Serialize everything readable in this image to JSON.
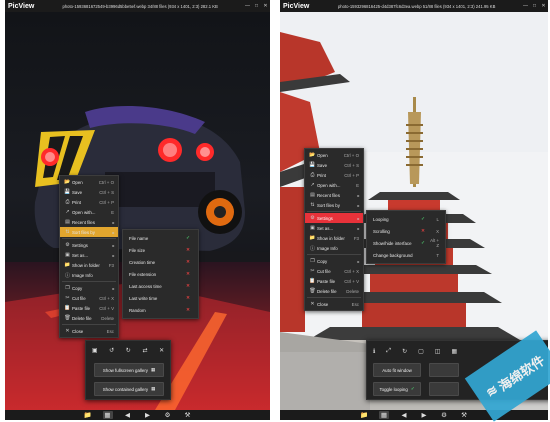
{
  "left": {
    "app_name": "PicView",
    "title": "photo-1593681672549-b3996d5bbe5ef.webp 34/88 files (934 x 1401, 2:3) 282.1 KB",
    "window_controls": [
      "minimize-icon",
      "maximize-icon",
      "close-icon"
    ],
    "context_menu": [
      {
        "icon": "folder-open-icon",
        "label": "Open",
        "shortcut": "Ctrl + O"
      },
      {
        "icon": "save-icon",
        "label": "Save",
        "shortcut": "Ctrl + S"
      },
      {
        "icon": "print-icon",
        "label": "Print",
        "shortcut": "Ctrl + P"
      },
      {
        "icon": "open-with-icon",
        "label": "Open with...",
        "shortcut": "E"
      },
      {
        "icon": "recent-files-icon",
        "label": "Recent files",
        "shortcut": ""
      },
      {
        "icon": "sort-icon",
        "label": "Sort files by",
        "shortcut": ""
      },
      {
        "icon": "settings-icon",
        "label": "Settings",
        "shortcut": ""
      },
      {
        "icon": "set-as-icon",
        "label": "Set as...",
        "shortcut": ""
      },
      {
        "icon": "folder-icon",
        "label": "Show in folder",
        "shortcut": "F3"
      },
      {
        "icon": "image-info-icon",
        "label": "Image Info",
        "shortcut": ""
      },
      {
        "icon": "copy-icon",
        "label": "Copy",
        "shortcut": ""
      },
      {
        "icon": "cut-icon",
        "label": "Cut file",
        "shortcut": "Ctrl + X"
      },
      {
        "icon": "paste-icon",
        "label": "Paste file",
        "shortcut": "Ctrl + V"
      },
      {
        "icon": "delete-icon",
        "label": "Delete file",
        "shortcut": "Delete"
      },
      {
        "icon": "close-icon",
        "label": "Close",
        "shortcut": "Esc"
      }
    ],
    "sort_submenu": [
      {
        "label": "File name",
        "checked": true
      },
      {
        "label": "File size",
        "checked": false
      },
      {
        "label": "Creation time",
        "checked": false
      },
      {
        "label": "File extension",
        "checked": false
      },
      {
        "label": "Last access time",
        "checked": false
      },
      {
        "label": "Last write time",
        "checked": false
      },
      {
        "label": "Random",
        "checked": false
      }
    ],
    "gallery_panel": {
      "icons": [
        "crop-icon",
        "rotate-left-icon",
        "rotate-right-icon",
        "flip-icon",
        "close-icon"
      ],
      "fullscreen_gallery": "Show fullscreen gallery",
      "contained_gallery": "Show contained gallery"
    },
    "bottom_bar": [
      "folder-icon",
      "gallery-icon",
      "previous-icon",
      "next-icon",
      "settings-icon",
      "tools-icon"
    ]
  },
  "right": {
    "app_name": "PicView",
    "title": "photo-1593296816425-d4d387fc6d3ea.webp 51/88 files (934 x 1401, 2:3) 241.95 KB",
    "window_controls": [
      "minimize-icon",
      "maximize-icon",
      "close-icon"
    ],
    "context_menu": [
      {
        "icon": "folder-open-icon",
        "label": "Open",
        "shortcut": "Ctrl + O"
      },
      {
        "icon": "save-icon",
        "label": "Save",
        "shortcut": "Ctrl + S"
      },
      {
        "icon": "print-icon",
        "label": "Print",
        "shortcut": "Ctrl + P"
      },
      {
        "icon": "open-with-icon",
        "label": "Open with...",
        "shortcut": "E"
      },
      {
        "icon": "recent-files-icon",
        "label": "Recent files",
        "shortcut": ""
      },
      {
        "icon": "sort-icon",
        "label": "Sort files by",
        "shortcut": ""
      },
      {
        "icon": "settings-icon",
        "label": "Settings",
        "shortcut": ""
      },
      {
        "icon": "set-as-icon",
        "label": "Set as...",
        "shortcut": ""
      },
      {
        "icon": "folder-icon",
        "label": "Show in folder",
        "shortcut": "F3"
      },
      {
        "icon": "image-info-icon",
        "label": "Image Info",
        "shortcut": ""
      },
      {
        "icon": "copy-icon",
        "label": "Copy",
        "shortcut": ""
      },
      {
        "icon": "cut-icon",
        "label": "Cut file",
        "shortcut": "Ctrl + X"
      },
      {
        "icon": "paste-icon",
        "label": "Paste file",
        "shortcut": "Ctrl + V"
      },
      {
        "icon": "delete-icon",
        "label": "Delete file",
        "shortcut": "Delete"
      },
      {
        "icon": "close-icon",
        "label": "Close",
        "shortcut": "Esc"
      }
    ],
    "settings_submenu": [
      {
        "label": "Looping",
        "mark": "check",
        "shortcut": "L"
      },
      {
        "label": "Scrolling",
        "mark": "x",
        "shortcut": "X"
      },
      {
        "label": "Show/hide interface",
        "mark": "check",
        "shortcut": "Alt + Z"
      },
      {
        "label": "Change background",
        "mark": "",
        "shortcut": "T"
      }
    ],
    "tools_panel": {
      "icons": [
        "info-icon",
        "resize-icon",
        "rotate-icon",
        "crop-icon",
        "fit-icon",
        "gallery-icon"
      ],
      "auto_fit_label": "Auto fit window",
      "toggle_looping_label": "Toggle looping",
      "toggle_looping_icon": "check-icon"
    },
    "bottom_bar": [
      "folder-icon",
      "gallery-icon",
      "previous-icon",
      "next-icon",
      "settings-icon",
      "tools-icon"
    ]
  },
  "watermark": {
    "text": "海绵软件",
    "color": "#33a6d2"
  }
}
